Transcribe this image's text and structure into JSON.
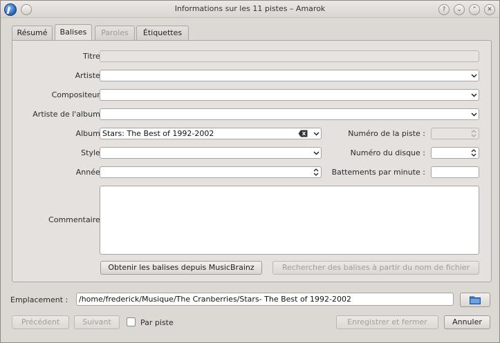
{
  "window": {
    "title": "Informations sur les 11 pistes – Amarok"
  },
  "titlebar_buttons": [
    "?",
    "⌄",
    "⌃",
    "✕"
  ],
  "tabs": [
    {
      "label": "Résumé",
      "state": "normal"
    },
    {
      "label": "Balises",
      "state": "active"
    },
    {
      "label": "Paroles",
      "state": "disabled"
    },
    {
      "label": "Étiquettes",
      "state": "normal"
    }
  ],
  "form": {
    "title_label": "Titre :",
    "title_value": "",
    "artist_label": "Artiste :",
    "artist_value": "",
    "composer_label": "Compositeur :",
    "composer_value": "",
    "album_artist_label": "Artiste de l'album :",
    "album_artist_value": "",
    "album_label": "Album :",
    "album_value": "Stars: The Best of 1992-2002",
    "track_number_label": "Numéro de la piste :",
    "track_number_value": "",
    "style_label": "Style :",
    "style_value": "",
    "disc_number_label": "Numéro du disque :",
    "disc_number_value": "",
    "year_label": "Année :",
    "year_value": "",
    "bpm_label": "Battements par minute :",
    "bpm_value": "",
    "comment_label": "Commentaire :",
    "comment_value": ""
  },
  "actions": {
    "musicbrainz_button": "Obtenir les balises depuis MusicBrainz",
    "from_filename_button": "Rechercher des balises à partir du nom de fichier"
  },
  "location": {
    "label": "Emplacement :",
    "value": "/home/frederick/Musique/The Cranberries/Stars- The Best of 1992-2002"
  },
  "footer": {
    "previous_button": "Précédent",
    "next_button": "Suivant",
    "per_track_label": "Par piste",
    "save_close_button": "Enregistrer et fermer",
    "cancel_button": "Annuler"
  }
}
